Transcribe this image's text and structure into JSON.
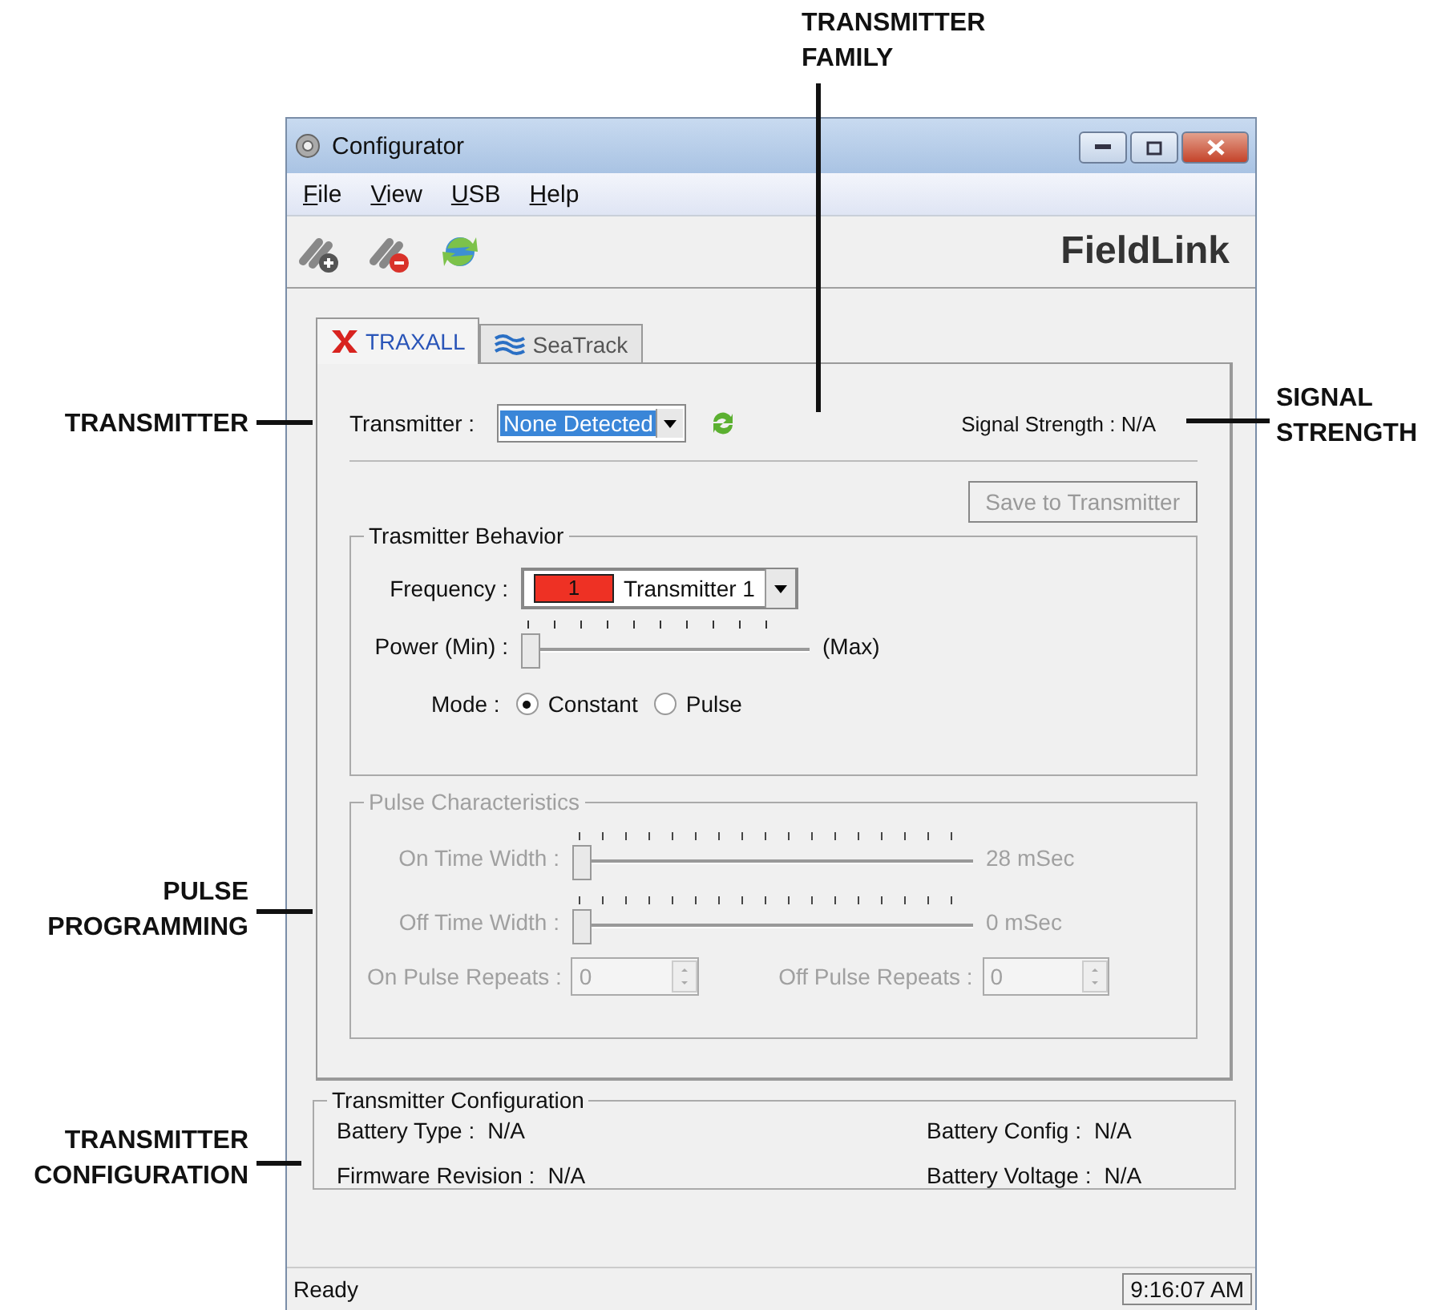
{
  "annotations": [
    {
      "label": "TRANSMITTER\nFAMILY"
    },
    {
      "label": "TRANSMITTER"
    },
    {
      "label": "SIGNAL\nSTRENGTH"
    },
    {
      "label": "PULSE\nPROGRAMMING"
    },
    {
      "label": "TRANSMITTER\nCONFIGURATION"
    }
  ],
  "window": {
    "title": "Configurator"
  },
  "menu": [
    "File",
    "View",
    "USB",
    "Help"
  ],
  "logo": "FieldLink",
  "tabs": [
    {
      "label": "TRAXALL",
      "selected": true
    },
    {
      "label": "SeaTrack",
      "selected": false
    }
  ],
  "transmitter": {
    "label": "Transmitter :",
    "value": "None Detected"
  },
  "signal_strength": "Signal Strength : N/A",
  "save_button": {
    "label": "Save to Transmitter",
    "disabled": true
  },
  "behavior": {
    "title": "Trasmitter Behavior",
    "frequency_label": "Frequency :",
    "channel": {
      "label": "1",
      "color": "#ee3124"
    },
    "channel_name": "Transmitter 1",
    "power": {
      "label": "Power (Min) :",
      "level": 0,
      "max": "(Max)"
    },
    "mode_label": "Mode :",
    "modes": [
      {
        "label": "Constant",
        "selected": true
      },
      {
        "label": "Pulse",
        "selected": false
      }
    ]
  },
  "pulse": {
    "title": "Pulse Characteristics",
    "disabled": true,
    "sliders": [
      {
        "label": "On Time Width :",
        "level": 0,
        "reading": "28 mSec"
      },
      {
        "label": "Off Time Width :",
        "level": 0,
        "reading": "0 mSec"
      }
    ],
    "repeats": [
      {
        "label": "On Pulse Repeats :",
        "value": "0"
      },
      {
        "label": "Off Pulse Repeats :",
        "value": "0"
      }
    ]
  },
  "configuration": {
    "title": "Transmitter Configuration",
    "fields": [
      {
        "label": "Battery Type :",
        "value": "N/A"
      },
      {
        "label": "Battery Config :",
        "value": "N/A"
      },
      {
        "label": "Firmware Revision :",
        "value": "N/A"
      },
      {
        "label": "Battery Voltage :",
        "value": "N/A"
      }
    ]
  },
  "status_bar": {
    "text": "Ready",
    "time": "9:16:07 AM"
  }
}
